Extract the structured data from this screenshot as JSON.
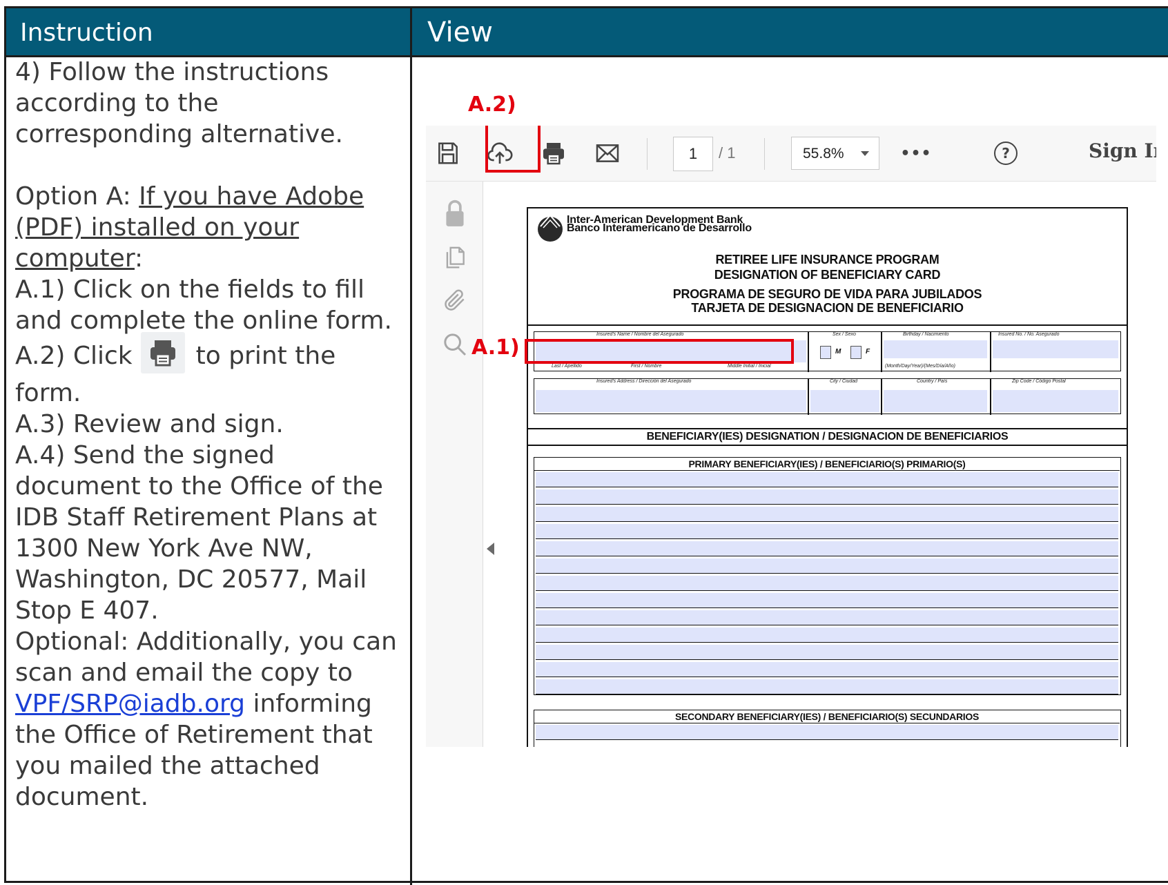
{
  "table": {
    "header_instruction": "Instruction",
    "header_view": "View"
  },
  "instructions": {
    "step_title": "4) Follow the instructions according to the corresponding alternative.",
    "option_label": "Option A",
    "option_colon": ": ",
    "option_condition": "If you have Adobe (PDF) installed on your computer",
    "option_end": ":",
    "a1_num": "A.1)",
    "a1_text": " Click on the fields to fill and complete the online form.",
    "a2_num": "A.2)",
    "a2_pre": " Click",
    "a2_post": "to print the form.",
    "a3_num": "A.3)",
    "a3_text": " Review and sign.",
    "a4_num": "A.4)",
    "a4_text": " Send the signed document to the Office of the IDB Staff Retirement Plans at 1300 New York Ave NW, Washington, DC 20577, Mail Stop E 407.",
    "optional_pre": "Optional: Additionally, you can scan and email the copy to ",
    "email": "VPF/SRP@iadb.org",
    "optional_post": " informing the Office of Retirement that you mailed the attached document."
  },
  "viewer": {
    "toolbar": {
      "page_current": "1",
      "page_total": "/ 1",
      "zoom": "55.8%",
      "more": "•••",
      "help": "?",
      "sign_in": "Sign In"
    },
    "icons": {
      "save": "save-icon",
      "upload": "cloud-upload-icon",
      "print": "print-icon",
      "email": "envelope-icon",
      "lock": "lock-icon",
      "pages": "pages-icon",
      "attachment": "paperclip-icon",
      "search": "search-icon"
    }
  },
  "form": {
    "org_en": "Inter-American Development Bank",
    "org_es": "Banco Interamericano de Desarrollo",
    "title1": "RETIREE LIFE INSURANCE PROGRAM",
    "title2": "DESIGNATION OF BENEFICIARY CARD",
    "title3": "PROGRAMA DE SEGURO DE VIDA PARA JUBILADOS",
    "title4": "TARJETA DE DESIGNACION DE BENEFICIARIO",
    "lbl_name": "Insured's Name / Nombre del Asegurado",
    "lbl_sex": "Sex / Sexo",
    "lbl_birthday": "Birthday / Nacimiento",
    "lbl_insured_no": "Insured No. / No. Asegurado",
    "lbl_last": "Last / Apellido",
    "lbl_first": "First / Nombre",
    "lbl_middle": "Middle Initial / Inicial",
    "lbl_date_fmt": "(Month/Day/Year)/(Mes/Día/Año)",
    "m": "M",
    "f": "F",
    "lbl_address": "Insured's Address / Dirección del Asegurado",
    "lbl_city": "City / Ciudad",
    "lbl_country": "Country / País",
    "lbl_zip": "Zip Code / Código Postal",
    "beneficiary_designation": "BENEFICIARY(IES) DESIGNATION / DESIGNACION DE BENEFICIARIOS",
    "primary": "PRIMARY BENEFICIARY(IES) / BENEFICIARIO(S) PRIMARIO(S)",
    "secondary": "SECONDARY BENEFICIARY(IES) / BENEFICIARIO(S) SECUNDARIOS"
  },
  "callouts": {
    "a1": "A.1)",
    "a2": "A.2)"
  },
  "colors": {
    "header_bg": "#045a78",
    "callout": "#e3000f",
    "field_fill": "#dfe4fb",
    "link": "#1a3fd6"
  }
}
